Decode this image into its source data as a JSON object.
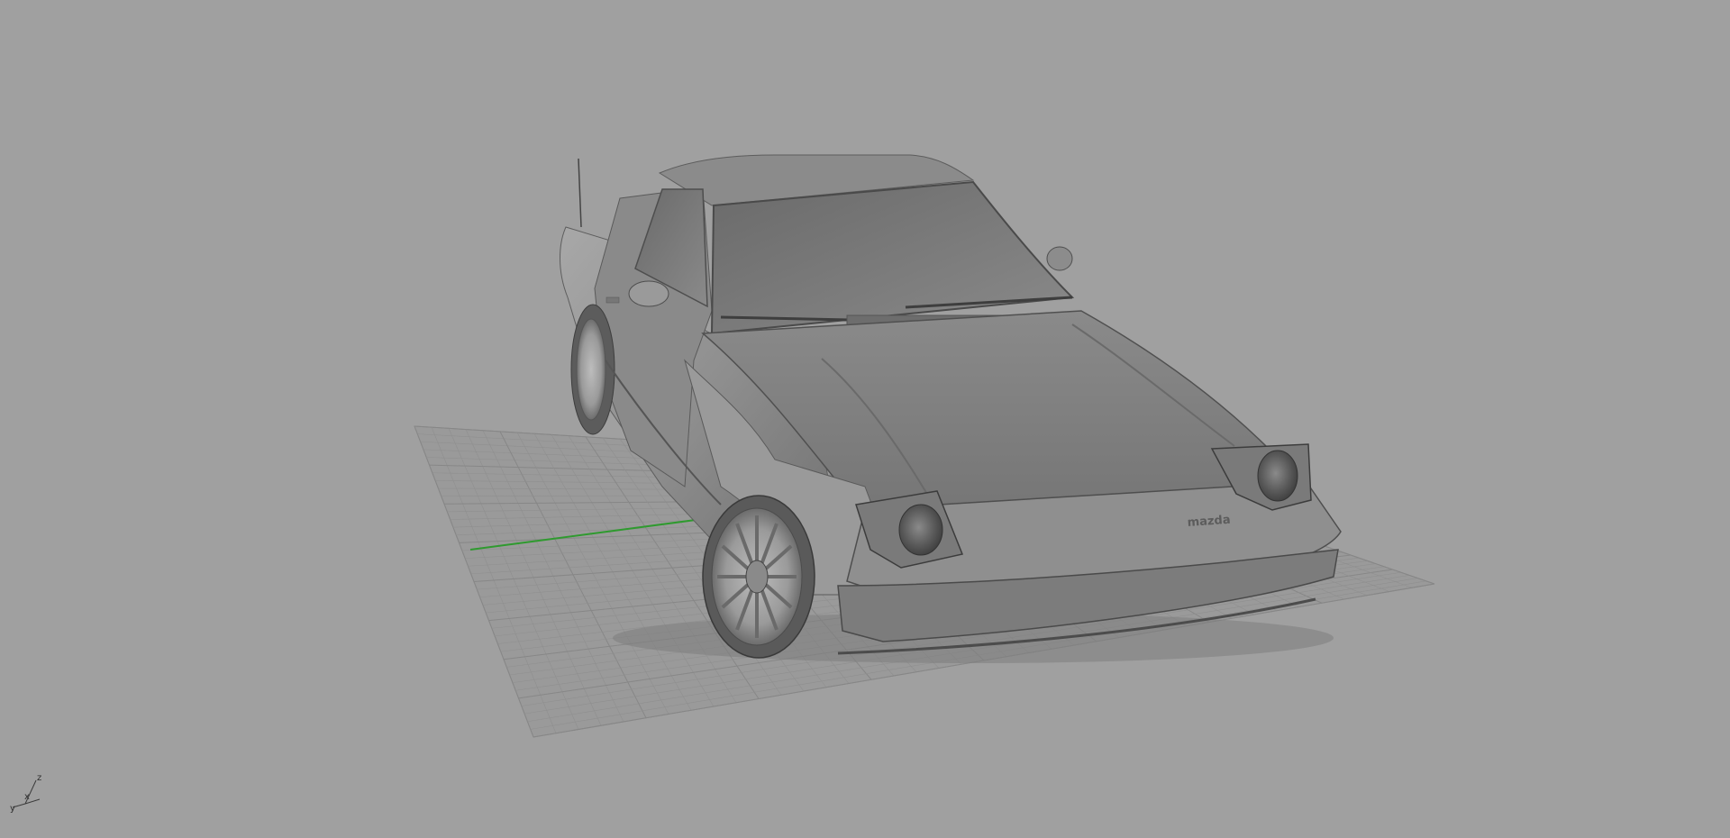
{
  "viewport": {
    "background": "#a0a0a0",
    "display_mode": "shaded",
    "grid": {
      "visible": true,
      "line_color": "#8f8f8f",
      "major_line_color": "#878787",
      "x_axis_color": "#2f9a2f"
    }
  },
  "model": {
    "name": "car-model",
    "brand_badge": "mazda",
    "body_color": "#8c8c8c"
  },
  "axis_gizmo": {
    "labels": {
      "z": "z",
      "x": "x",
      "y": "y"
    }
  }
}
